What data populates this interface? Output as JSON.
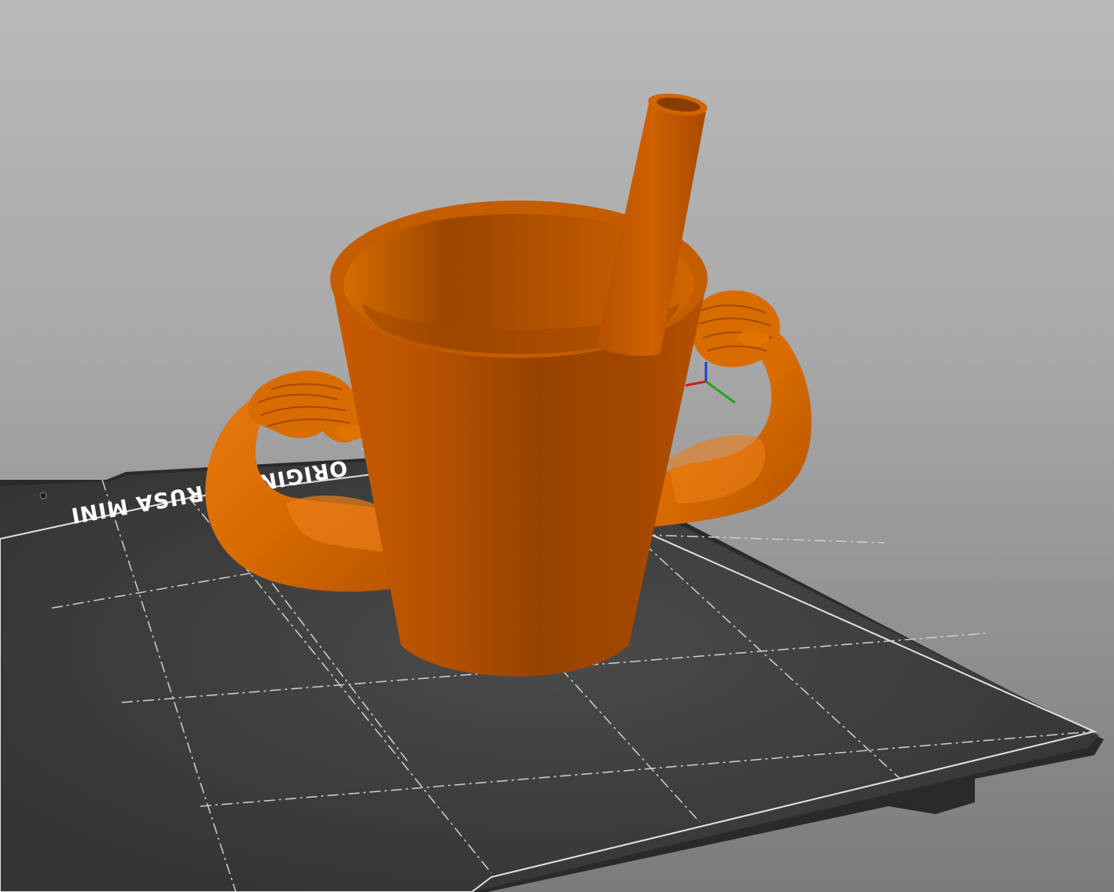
{
  "viewport": {
    "name": "3D view"
  },
  "print_bed": {
    "label": "ORIGINAL PRUSA MINI",
    "surface_color": "#3b3b3b",
    "border_color": "#1f1f1f",
    "grid_line_color": "#d8d8d8"
  },
  "model": {
    "name": "cup-with-arms",
    "color": "#e06800",
    "parts": [
      "cup-body",
      "straw",
      "left-arm",
      "right-arm"
    ]
  },
  "axes": {
    "x_color": "#d11a1a",
    "y_color": "#21a321",
    "z_color": "#1f3fd6"
  }
}
